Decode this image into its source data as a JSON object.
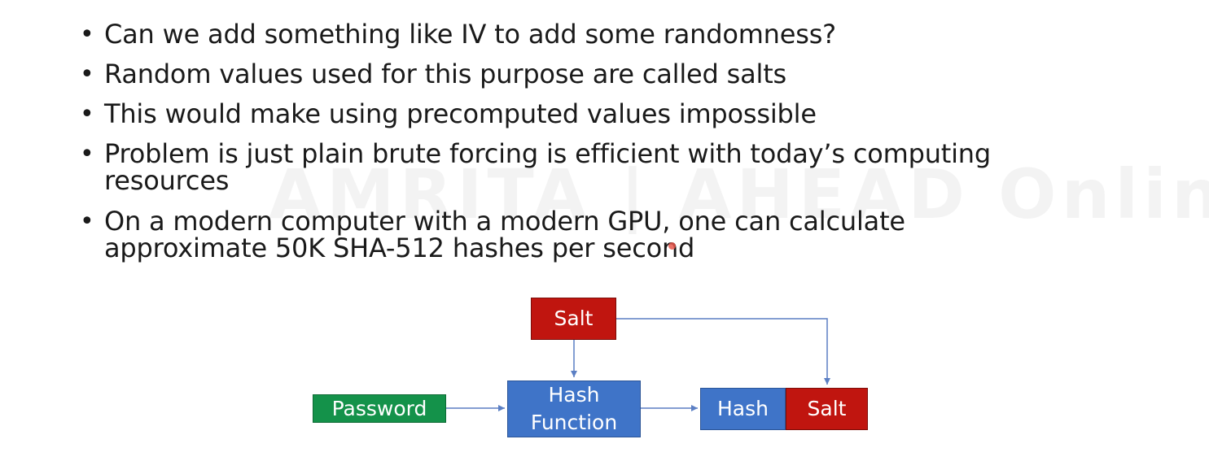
{
  "bullets": [
    "Can we add something like IV to add some randomness?",
    "Random values used for this purpose are called salts",
    "This would make using precomputed values impossible",
    "Problem is just plain brute forcing is efficient with today’s computing resources",
    "On a modern computer with a modern GPU, one can calculate approximate 50K SHA-512 hashes per second"
  ],
  "bullet_symbol": "•",
  "watermark": "AMRITA | AHEAD Online",
  "diagram": {
    "salt_top": "Salt",
    "password": "Password",
    "hash_function": "Hash Function",
    "output_hash": "Hash",
    "output_salt": "Salt"
  },
  "colors": {
    "salt": "#c0150f",
    "hash": "#3f74c8",
    "password": "#14924a",
    "arrow": "#5b7fc4"
  }
}
